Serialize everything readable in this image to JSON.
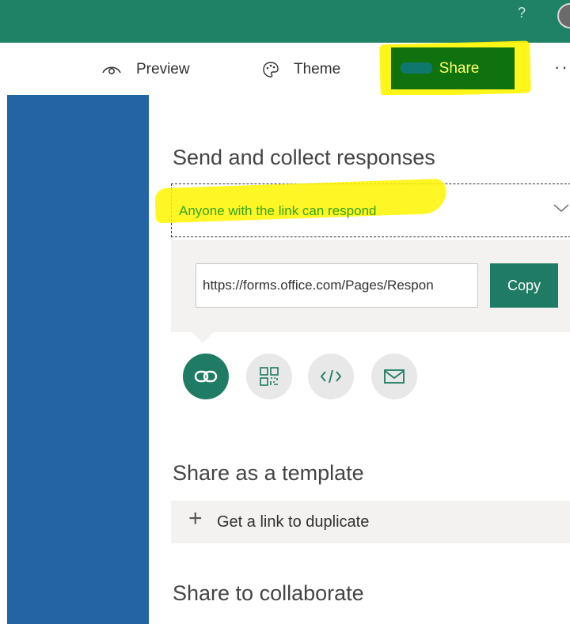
{
  "topbar": {
    "help_glyph": "?",
    "accent_color": "#1f8165"
  },
  "toolbar": {
    "preview_label": "Preview",
    "theme_label": "Theme",
    "share_label": "Share",
    "more_label": "··"
  },
  "share_panel": {
    "send_title": "Send and collect responses",
    "permission": "Anyone with the link can respond",
    "link_url": "https://forms.office.com/Pages/Respon",
    "copy_label": "Copy",
    "share_options": [
      "link-icon",
      "qr-code-icon",
      "embed-code-icon",
      "email-icon"
    ],
    "template_title": "Share as a template",
    "duplicate_plus": "+",
    "duplicate_label": "Get a link to duplicate",
    "collaborate_title": "Share to collaborate"
  },
  "colors": {
    "highlight": "#fff500",
    "share_button": "#10710f",
    "copy_button": "#1f7b63",
    "sidebar": "#2463a4",
    "permission_text": "#36a51a"
  }
}
